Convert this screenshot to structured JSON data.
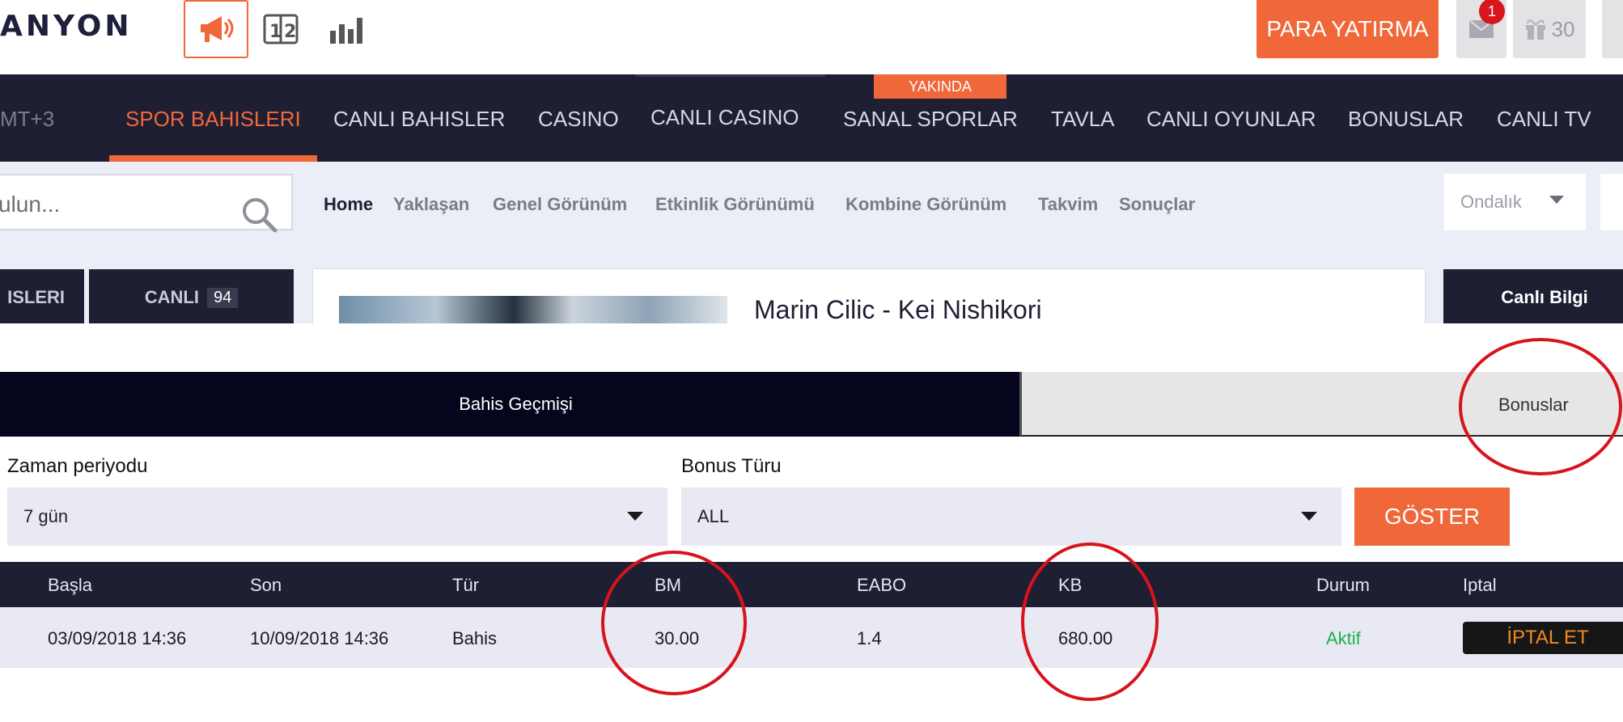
{
  "header": {
    "logo_text": "ANYON",
    "deposit_label": "PARA YATIRMA",
    "mail_badge": "1",
    "gift_count": "30",
    "icons": [
      "megaphone-icon",
      "scoreboard-icon",
      "stats-icon",
      "mail-icon",
      "gift-icon"
    ]
  },
  "nav": {
    "timezone": "MT+3",
    "items": [
      "SPOR BAHISLERI",
      "CANLI BAHISLER",
      "CASINO",
      "CANLI CASINO",
      "SANAL SPORLAR",
      "TAVLA",
      "CANLI OYUNLAR",
      "BONUSLAR",
      "CANLI TV"
    ],
    "soon_badge": "YAKINDA"
  },
  "subnav": {
    "search_placeholder": "ulun...",
    "links": [
      "Home",
      "Yaklaşan",
      "Genel Görünüm",
      "Etkinlik Görünümü",
      "Kombine Görünüm",
      "Takvim",
      "Sonuçlar"
    ],
    "odds_format": "Ondalık"
  },
  "sidebar_tabs": {
    "sports_partial": "ISLERI",
    "live_label": "CANLI",
    "live_count": "94"
  },
  "event": {
    "title": "Marin Cilic - Kei Nishikori",
    "info_label": "Canlı Bilgi"
  },
  "panel": {
    "tabs": [
      "Bahis Geçmişi",
      "Bonuslar"
    ],
    "period_label": "Zaman periyodu",
    "period_value": "7 gün",
    "bonus_type_label": "Bonus Türu",
    "bonus_type_value": "ALL",
    "show_button": "GÖSTER"
  },
  "table": {
    "headers": [
      "Başla",
      "Son",
      "Tür",
      "BM",
      "EABO",
      "KB",
      "Durum",
      "Iptal"
    ],
    "row": {
      "start": "03/09/2018 14:36",
      "end": "10/09/2018 14:36",
      "type": "Bahis",
      "bm": "30.00",
      "eabo": "1.4",
      "kb": "680.00",
      "status": "Aktif",
      "cancel": "İPTAL ET"
    }
  },
  "colors": {
    "accent": "#f0673a",
    "nav_bg": "#1e1f33",
    "panel_dark": "#05051e",
    "status_active": "#1fb04d",
    "annotation_red": "#d7141c"
  }
}
